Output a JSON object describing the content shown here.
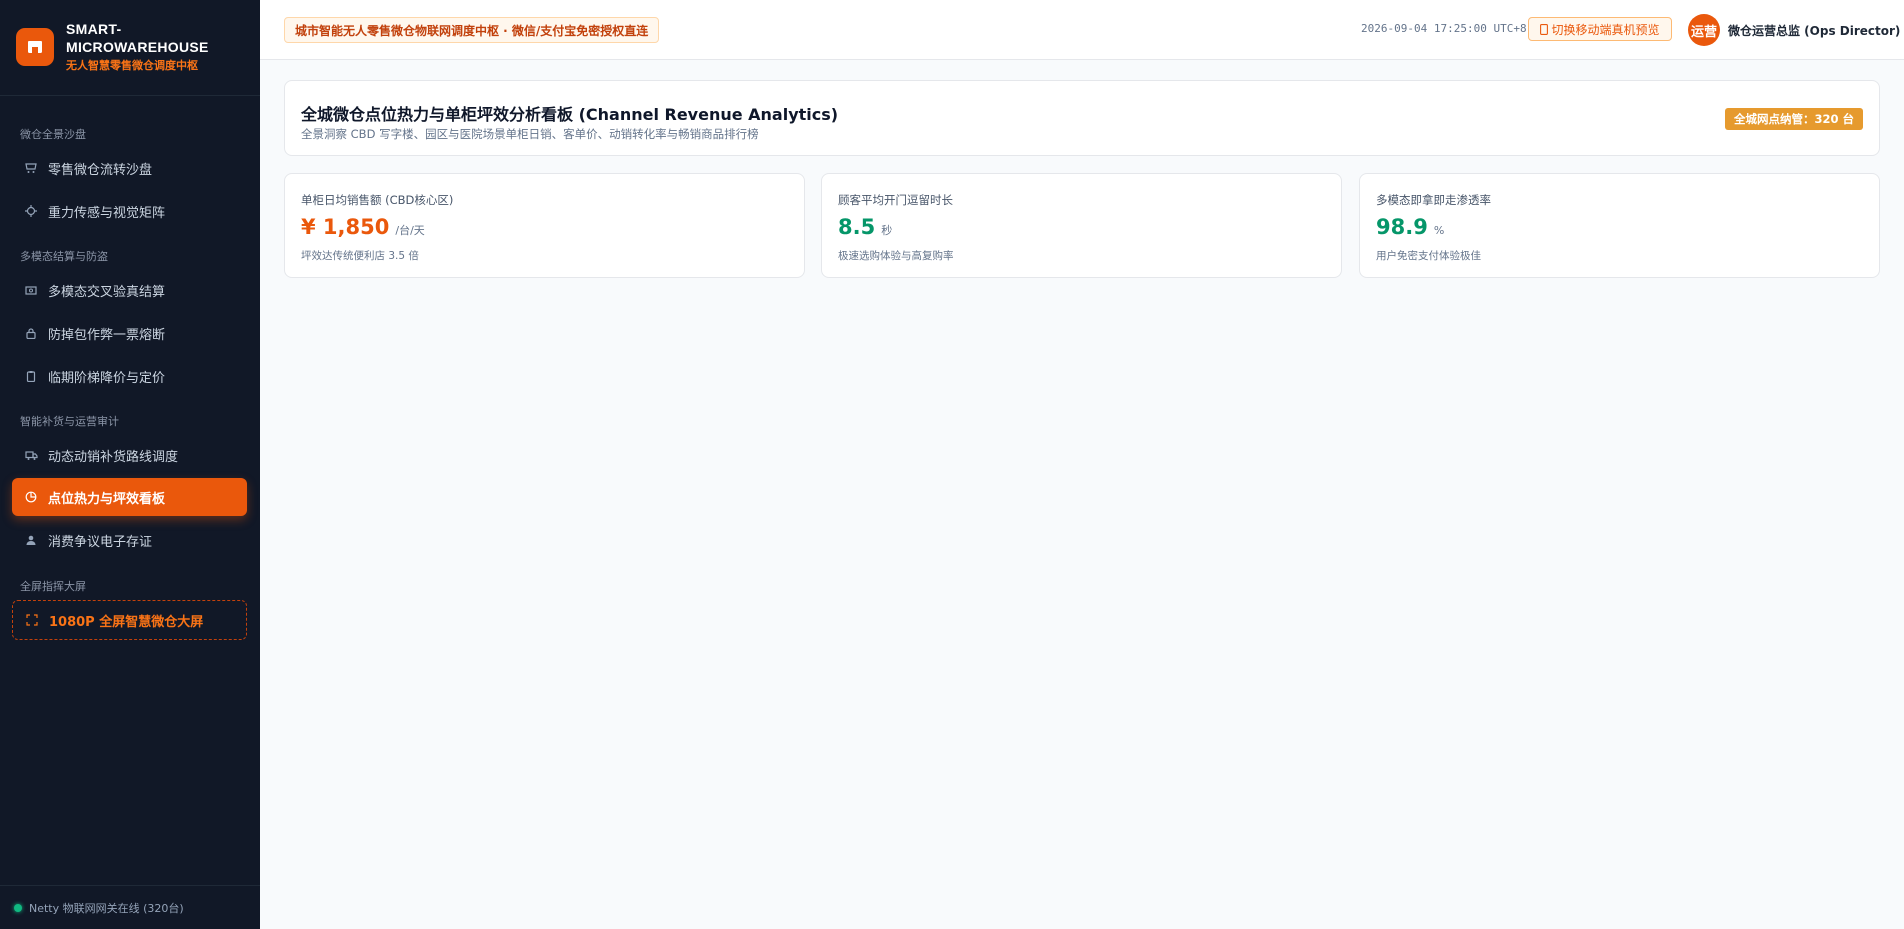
{
  "brand": {
    "title": "SMART-MICROWAREHOUSE",
    "subtitle": "无人智慧零售微仓调度中枢",
    "accent": "#ea580c"
  },
  "sidebar": {
    "groups": [
      {
        "label": "微仓全景沙盘"
      },
      {
        "label": "多模态结算与防盗"
      },
      {
        "label": "智能补货与运营审计"
      },
      {
        "label": "全屏指挥大屏"
      }
    ],
    "items": [
      {
        "label": "零售微仓流转沙盘",
        "icon": "storefront-icon"
      },
      {
        "label": "重力传感与视觉矩阵",
        "icon": "sensor-icon"
      },
      {
        "label": "多模态交叉验真结算",
        "icon": "cash-icon"
      },
      {
        "label": "防掉包作弊一票熔断",
        "icon": "lock-icon"
      },
      {
        "label": "临期阶梯降价与定价",
        "icon": "clipboard-icon"
      },
      {
        "label": "动态动销补货路线调度",
        "icon": "truck-icon"
      },
      {
        "label": "点位热力与坪效看板",
        "icon": "pie-chart-icon",
        "active": true
      },
      {
        "label": "消费争议电子存证",
        "icon": "user-icon"
      },
      {
        "label": "1080P 全屏智慧微仓大屏",
        "icon": "fullscreen-icon"
      }
    ],
    "footer": "Netty 物联网网关在线 (320台)"
  },
  "topbar": {
    "notice": "城市智能无人零售微仓物联网调度中枢 · 微信/支付宝免密授权直连",
    "datetime": "2026-09-04 17:25:00 UTC+8",
    "mobile_preview": "切换移动端真机预览",
    "avatar_text": "运营",
    "user_name": "微仓运营总监 (Ops Director)"
  },
  "header": {
    "title": "全城微仓点位热力与单柜坪效分析看板 (Channel Revenue Analytics)",
    "subtitle": "全景洞察 CBD 写字楼、园区与医院场景单柜日销、客单价、动销转化率与畅销商品排行榜",
    "badge": "全城网点纳管：320 台"
  },
  "kpis": [
    {
      "label": "单柜日均销售额 (CBD核心区)",
      "value": "¥ 1,850",
      "unit": "/台/天",
      "note": "坪效达传统便利店 3.5 倍",
      "color": "#ea580c"
    },
    {
      "label": "顾客平均开门逗留时长",
      "value": "8.5",
      "unit": "秒",
      "note": "极速选购体验与高复购率",
      "color": "#059669"
    },
    {
      "label": "多模态即拿即走渗透率",
      "value": "98.9",
      "unit": "%",
      "note": "用户免密支付体验极佳",
      "color": "#059669"
    }
  ]
}
